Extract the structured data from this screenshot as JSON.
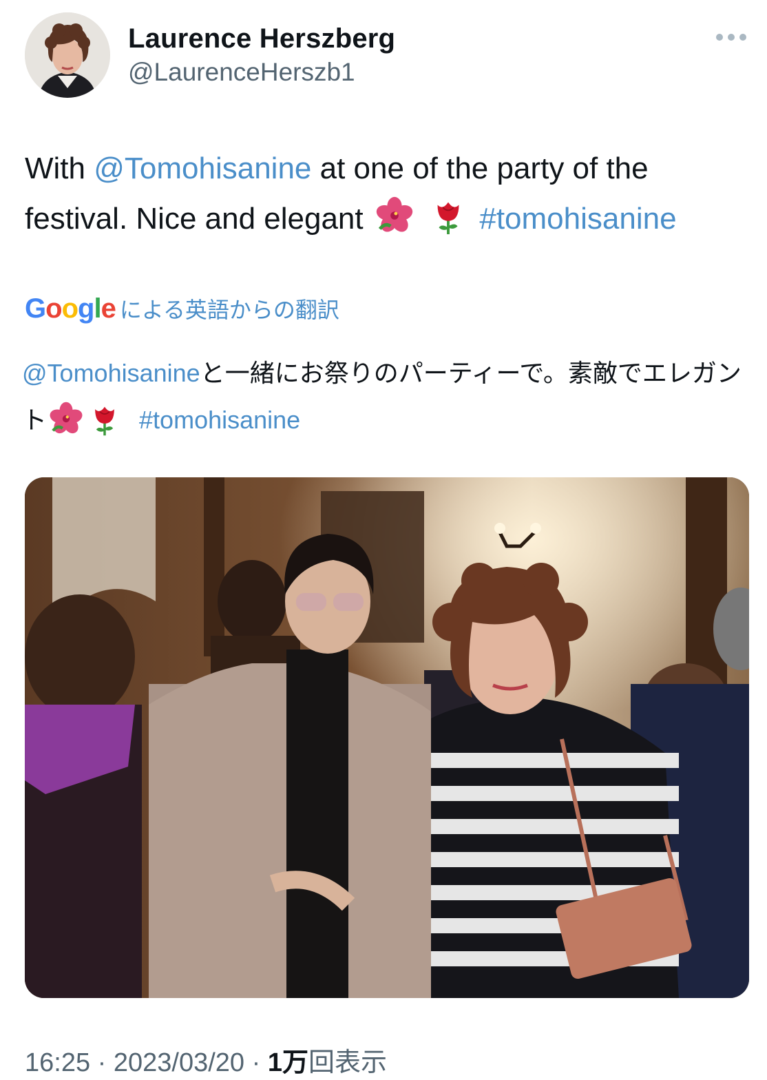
{
  "author": {
    "display_name": "Laurence Herszberg",
    "handle": "@LaurenceHerszb1"
  },
  "tweet": {
    "text_prefix": "With ",
    "mention": "@Tomohisanine",
    "text_middle": " at one of the party of the festival. Nice and elegant",
    "emojis": [
      "hibiscus-icon",
      "rose-icon"
    ],
    "hashtag": "#tomohisanine"
  },
  "translation": {
    "logo": "Google",
    "label": "による英語からの翻訳",
    "mention": "@Tomohisanine",
    "text": "と一緒にお祭りのパーティーで。素敵でエレガント",
    "hashtag": "#tomohisanine"
  },
  "meta": {
    "time": "16:25",
    "separator": " · ",
    "date": "2023/03/20",
    "views_count": "1万",
    "views_label": "回表示"
  },
  "colors": {
    "link": "#4a8ec9",
    "secondary_text": "#536471",
    "primary_text": "#0f1419"
  }
}
